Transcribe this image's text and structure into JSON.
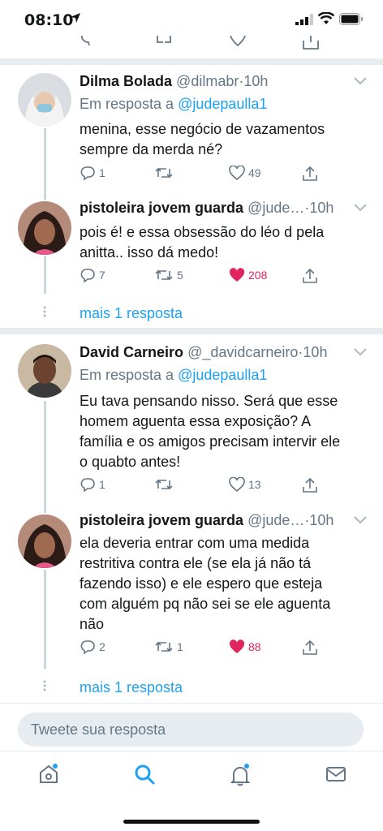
{
  "status_bar": {
    "time": "08:10"
  },
  "replies": [
    {
      "name": "Dilma Bolada",
      "handle": "@dilmabr",
      "time": "·10h",
      "in_reply_prefix": "Em resposta a ",
      "in_reply_mention": "@judepaulla1",
      "lines": [
        "menina, esse negócio de vazamentos",
        "sempre da merda né?"
      ],
      "reply_count": "1",
      "retweet_count": "",
      "like_count": "49",
      "liked": false
    },
    {
      "name": "pistoleira jovem guarda",
      "handle": "@jude…",
      "time": "·10h",
      "lines": [
        "pois é! e essa obsessão do léo d pela",
        "anitta.. isso dá medo!"
      ],
      "reply_count": "7",
      "retweet_count": "5",
      "like_count": "208",
      "liked": true
    },
    {
      "name": "David Carneiro",
      "handle": "@_davidcarneiro",
      "time": "·10h",
      "in_reply_prefix": "Em resposta a ",
      "in_reply_mention": "@judepaulla1",
      "lines": [
        "Eu tava pensando nisso. Será que esse",
        "homem aguenta essa exposição? A",
        "família e os amigos precisam intervir ele",
        "o quabto antes!"
      ],
      "reply_count": "1",
      "retweet_count": "",
      "like_count": "13",
      "liked": false
    },
    {
      "name": "pistoleira jovem guarda",
      "handle": "@jude…",
      "time": "·10h",
      "lines": [
        "ela deveria entrar com uma medida",
        "restritiva contra ele (se ela já não tá",
        "fazendo isso) e ele espero que esteja",
        "com alguém pq não sei se ele aguenta",
        "não"
      ],
      "reply_count": "2",
      "retweet_count": "1",
      "like_count": "88",
      "liked": true
    }
  ],
  "more_replies": [
    "mais 1 resposta",
    "mais 1 resposta"
  ],
  "reply_bar": {
    "placeholder": "Tweete sua resposta"
  },
  "tabs": [
    "home-icon",
    "search-icon",
    "notifications-icon",
    "messages-icon"
  ],
  "colors": {
    "accent": "#1da1f2",
    "like": "#e0245e",
    "muted": "#657786",
    "separator": "#e6ecf0"
  }
}
